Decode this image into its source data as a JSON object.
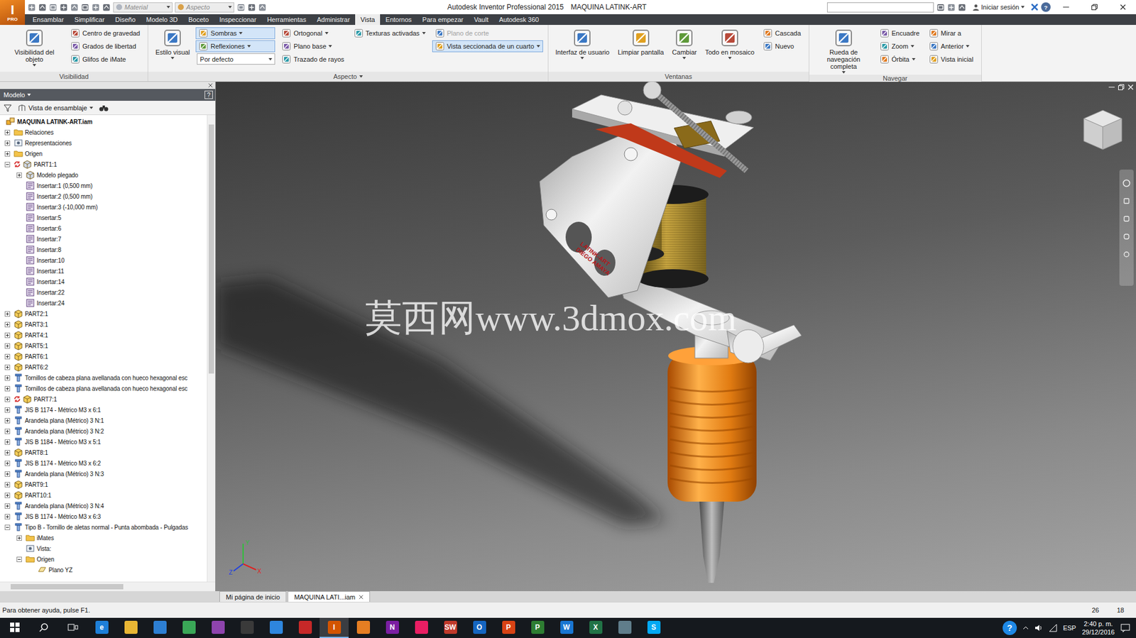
{
  "app": {
    "logo": "I",
    "edition": "PRO"
  },
  "window": {
    "title": "Autodesk Inventor Professional 2015",
    "document": "MAQUINA LATINK-ART"
  },
  "quick_access": {
    "material": "Material",
    "appearance": "Aspecto",
    "sign_in": "Iniciar sesión",
    "help": "?"
  },
  "tabs": [
    {
      "label": "Ensamblar",
      "selected": false
    },
    {
      "label": "Simplificar",
      "selected": false
    },
    {
      "label": "Diseño",
      "selected": false
    },
    {
      "label": "Modelo 3D",
      "selected": false
    },
    {
      "label": "Boceto",
      "selected": false
    },
    {
      "label": "Inspeccionar",
      "selected": false
    },
    {
      "label": "Herramientas",
      "selected": false
    },
    {
      "label": "Administrar",
      "selected": false
    },
    {
      "label": "Vista",
      "selected": true
    },
    {
      "label": "Entornos",
      "selected": false
    },
    {
      "label": "Para empezar",
      "selected": false
    },
    {
      "label": "Vault",
      "selected": false
    },
    {
      "label": "Autodesk 360",
      "selected": false
    }
  ],
  "ribbon": {
    "panels": [
      {
        "label": "Visibilidad",
        "menu": false,
        "groups": [
          {
            "kind": "large",
            "buttons": [
              {
                "label": "Visibilidad del objeto",
                "kind": "button",
                "dropdown": true,
                "selected": false,
                "disabled": false
              }
            ]
          },
          {
            "kind": "column",
            "buttons": [
              {
                "label": "Centro de gravedad",
                "kind": "button",
                "dropdown": false,
                "selected": false,
                "disabled": false
              },
              {
                "label": "Grados de libertad",
                "kind": "button",
                "dropdown": false,
                "selected": false,
                "disabled": false
              },
              {
                "label": "Glifos de iMate",
                "kind": "button",
                "dropdown": false,
                "selected": false,
                "disabled": false
              }
            ]
          }
        ]
      },
      {
        "label": "Aspecto",
        "menu": true,
        "groups": [
          {
            "kind": "large",
            "buttons": [
              {
                "label": "Estilo visual",
                "kind": "button",
                "dropdown": true,
                "selected": false,
                "disabled": false
              }
            ]
          },
          {
            "kind": "column",
            "buttons": [
              {
                "label": "Sombras",
                "kind": "button",
                "dropdown": true,
                "selected": true,
                "disabled": false
              },
              {
                "label": "Reflexiones",
                "kind": "button",
                "dropdown": true,
                "selected": true,
                "disabled": false
              },
              {
                "label": "Por defecto",
                "kind": "select",
                "dropdown": true,
                "selected": false,
                "disabled": false
              }
            ]
          },
          {
            "kind": "column",
            "buttons": [
              {
                "label": "Ortogonal",
                "kind": "button",
                "dropdown": true,
                "selected": false,
                "disabled": false
              },
              {
                "label": "Plano base",
                "kind": "button",
                "dropdown": true,
                "selected": false,
                "disabled": false
              },
              {
                "label": "Trazado de rayos",
                "kind": "button",
                "dropdown": false,
                "selected": false,
                "disabled": false
              }
            ]
          },
          {
            "kind": "column",
            "buttons": [
              {
                "label": "Texturas activadas",
                "kind": "button",
                "dropdown": true,
                "selected": false,
                "disabled": false
              }
            ]
          },
          {
            "kind": "column",
            "buttons": [
              {
                "label": "Plano de corte",
                "kind": "button",
                "dropdown": false,
                "selected": false,
                "disabled": true
              },
              {
                "label": "Vista seccionada de un cuarto",
                "kind": "button",
                "dropdown": true,
                "selected": true,
                "disabled": false
              }
            ]
          }
        ]
      },
      {
        "label": "Ventanas",
        "menu": false,
        "groups": [
          {
            "kind": "large",
            "buttons": [
              {
                "label": "Interfaz de usuario",
                "kind": "button",
                "dropdown": true,
                "selected": false,
                "disabled": false
              },
              {
                "label": "Limpiar pantalla",
                "kind": "button",
                "dropdown": false,
                "selected": false,
                "disabled": false
              },
              {
                "label": "Cambiar",
                "kind": "button",
                "dropdown": true,
                "selected": false,
                "disabled": false
              },
              {
                "label": "Todo en mosaico",
                "kind": "button",
                "dropdown": true,
                "selected": false,
                "disabled": false
              }
            ]
          },
          {
            "kind": "column",
            "buttons": [
              {
                "label": "Cascada",
                "kind": "button",
                "dropdown": false,
                "selected": false,
                "disabled": false
              },
              {
                "label": "Nuevo",
                "kind": "button",
                "dropdown": false,
                "selected": false,
                "disabled": false
              }
            ]
          }
        ]
      },
      {
        "label": "Navegar",
        "menu": false,
        "groups": [
          {
            "kind": "large",
            "buttons": [
              {
                "label": "Rueda de navegación completa",
                "kind": "button",
                "dropdown": true,
                "selected": false,
                "disabled": false
              }
            ]
          },
          {
            "kind": "column",
            "buttons": [
              {
                "label": "Encuadre",
                "kind": "button",
                "dropdown": false,
                "selected": false,
                "disabled": false
              },
              {
                "label": "Zoom",
                "kind": "button",
                "dropdown": true,
                "selected": false,
                "disabled": false
              },
              {
                "label": "Órbita",
                "kind": "button",
                "dropdown": true,
                "selected": false,
                "disabled": false
              }
            ]
          },
          {
            "kind": "column",
            "buttons": [
              {
                "label": "Mirar a",
                "kind": "button",
                "dropdown": false,
                "selected": false,
                "disabled": false
              },
              {
                "label": "Anterior",
                "kind": "button",
                "dropdown": true,
                "selected": false,
                "disabled": false
              },
              {
                "label": "Vista inicial",
                "kind": "button",
                "dropdown": false,
                "selected": false,
                "disabled": false
              }
            ]
          }
        ]
      }
    ]
  },
  "browser": {
    "title": "Modelo",
    "help": "?",
    "view": "Vista de ensamblaje",
    "tree": [
      {
        "label": "MAQUINA LATINK-ART.iam",
        "level": 0,
        "kind": "root",
        "expander": "none",
        "flag": false
      },
      {
        "label": "Relaciones",
        "level": 1,
        "kind": "folder",
        "expander": "collapsed",
        "flag": false
      },
      {
        "label": "Representaciones",
        "level": 1,
        "kind": "view",
        "expander": "collapsed",
        "flag": false
      },
      {
        "label": "Origen",
        "level": 1,
        "kind": "folder",
        "expander": "collapsed",
        "flag": false
      },
      {
        "label": "PART1:1",
        "level": 1,
        "kind": "sheet",
        "expander": "expanded",
        "flag": true
      },
      {
        "label": "Modelo plegado",
        "level": 2,
        "kind": "sheet",
        "expander": "collapsed",
        "flag": false
      },
      {
        "label": "Insertar:1 (0,500 mm)",
        "level": 2,
        "kind": "feature",
        "expander": "none",
        "flag": false
      },
      {
        "label": "Insertar:2 (0,500 mm)",
        "level": 2,
        "kind": "feature",
        "expander": "none",
        "flag": false
      },
      {
        "label": "Insertar:3 (-10,000 mm)",
        "level": 2,
        "kind": "feature",
        "expander": "none",
        "flag": false
      },
      {
        "label": "Insertar:5",
        "level": 2,
        "kind": "feature",
        "expander": "none",
        "flag": false
      },
      {
        "label": "Insertar:6",
        "level": 2,
        "kind": "feature",
        "expander": "none",
        "flag": false
      },
      {
        "label": "Insertar:7",
        "level": 2,
        "kind": "feature",
        "expander": "none",
        "flag": false
      },
      {
        "label": "Insertar:8",
        "level": 2,
        "kind": "feature",
        "expander": "none",
        "flag": false
      },
      {
        "label": "Insertar:10",
        "level": 2,
        "kind": "feature",
        "expander": "none",
        "flag": false
      },
      {
        "label": "Insertar:11",
        "level": 2,
        "kind": "feature",
        "expander": "none",
        "flag": false
      },
      {
        "label": "Insertar:14",
        "level": 2,
        "kind": "feature",
        "expander": "none",
        "flag": false
      },
      {
        "label": "Insertar:22",
        "level": 2,
        "kind": "feature",
        "expander": "none",
        "flag": false
      },
      {
        "label": "Insertar:24",
        "level": 2,
        "kind": "feature",
        "expander": "none",
        "flag": false
      },
      {
        "label": "PART2:1",
        "level": 1,
        "kind": "part",
        "expander": "collapsed",
        "flag": false
      },
      {
        "label": "PART3:1",
        "level": 1,
        "kind": "part",
        "expander": "collapsed",
        "flag": false
      },
      {
        "label": "PART4:1",
        "level": 1,
        "kind": "part",
        "expander": "collapsed",
        "flag": false
      },
      {
        "label": "PART5:1",
        "level": 1,
        "kind": "part",
        "expander": "collapsed",
        "flag": false
      },
      {
        "label": "PART6:1",
        "level": 1,
        "kind": "part",
        "expander": "collapsed",
        "flag": false
      },
      {
        "label": "PART6:2",
        "level": 1,
        "kind": "part",
        "expander": "collapsed",
        "flag": false
      },
      {
        "label": "Tornillos de cabeza plana avellanada con hueco hexagonal esc",
        "level": 1,
        "kind": "fastener",
        "expander": "collapsed",
        "flag": false
      },
      {
        "label": "Tornillos de cabeza plana avellanada con hueco hexagonal esc",
        "level": 1,
        "kind": "fastener",
        "expander": "collapsed",
        "flag": false
      },
      {
        "label": "PART7:1",
        "level": 1,
        "kind": "part",
        "expander": "collapsed",
        "flag": true
      },
      {
        "label": "JIS B 1174 - Métrico M3 x 6:1",
        "level": 1,
        "kind": "fastener",
        "expander": "collapsed",
        "flag": false
      },
      {
        "label": "Arandela plana (Métrico) 3 N:1",
        "level": 1,
        "kind": "fastener",
        "expander": "collapsed",
        "flag": false
      },
      {
        "label": "Arandela plana (Métrico) 3 N:2",
        "level": 1,
        "kind": "fastener",
        "expander": "collapsed",
        "flag": false
      },
      {
        "label": "JIS B 1184 - Métrico M3 x 5:1",
        "level": 1,
        "kind": "fastener",
        "expander": "collapsed",
        "flag": false
      },
      {
        "label": "PART8:1",
        "level": 1,
        "kind": "part",
        "expander": "collapsed",
        "flag": false
      },
      {
        "label": "JIS B 1174 - Métrico M3 x 6:2",
        "level": 1,
        "kind": "fastener",
        "expander": "collapsed",
        "flag": false
      },
      {
        "label": "Arandela plana (Métrico) 3 N:3",
        "level": 1,
        "kind": "fastener",
        "expander": "collapsed",
        "flag": false
      },
      {
        "label": "PART9:1",
        "level": 1,
        "kind": "part",
        "expander": "collapsed",
        "flag": false
      },
      {
        "label": "PART10:1",
        "level": 1,
        "kind": "part",
        "expander": "collapsed",
        "flag": false
      },
      {
        "label": "Arandela plana (Métrico) 3 N:4",
        "level": 1,
        "kind": "fastener",
        "expander": "collapsed",
        "flag": false
      },
      {
        "label": "JIS B 1174 - Métrico M3 x 6:3",
        "level": 1,
        "kind": "fastener",
        "expander": "collapsed",
        "flag": false
      },
      {
        "label": "Tipo B - Tornillo de aletas normal - Punta abombada - Pulgadas",
        "level": 1,
        "kind": "fastener",
        "expander": "expanded",
        "flag": false
      },
      {
        "label": "iMates",
        "level": 2,
        "kind": "folder",
        "expander": "collapsed",
        "flag": false
      },
      {
        "label": "Vista:",
        "level": 2,
        "kind": "view",
        "expander": "none",
        "flag": false
      },
      {
        "label": "Origen",
        "level": 2,
        "kind": "folder",
        "expander": "expanded",
        "flag": false
      },
      {
        "label": "Plano YZ",
        "level": 3,
        "kind": "plane",
        "expander": "none",
        "flag": false
      }
    ]
  },
  "viewport": {
    "watermark": "莫西网www.3dmox.com",
    "engraving": [
      "LATINK-ART",
      "DIEGO AMAYA"
    ],
    "axes": [
      "X",
      "Y",
      "Z"
    ]
  },
  "document_tabs": [
    {
      "label": "Mi página de inicio",
      "selected": false,
      "closable": false
    },
    {
      "label": "MAQUINA LATI...iam",
      "selected": true,
      "closable": true
    }
  ],
  "status_bar": {
    "help": "Para obtener ayuda, pulse F1.",
    "counts": [
      "26",
      "18"
    ]
  },
  "taskbar": {
    "apps": [
      {
        "letter": "e",
        "color": "#1e7fd8",
        "selected": false
      },
      {
        "letter": "",
        "color": "#e8b634",
        "selected": false
      },
      {
        "letter": "",
        "color": "#2d7fd3",
        "selected": false
      },
      {
        "letter": "",
        "color": "#3aa757",
        "selected": false
      },
      {
        "letter": "",
        "color": "#8e44ad",
        "selected": false
      },
      {
        "letter": "",
        "color": "#3a3a3a",
        "selected": false
      },
      {
        "letter": "",
        "color": "#2e86de",
        "selected": false
      },
      {
        "letter": "",
        "color": "#c62828",
        "selected": false
      },
      {
        "letter": "I",
        "color": "#d35400",
        "selected": true
      },
      {
        "letter": "",
        "color": "#e67e22",
        "selected": false
      },
      {
        "letter": "N",
        "color": "#7b1fa2",
        "selected": false
      },
      {
        "letter": "",
        "color": "#e91e63",
        "selected": false
      },
      {
        "letter": "SW",
        "color": "#c0392b",
        "selected": false
      },
      {
        "letter": "O",
        "color": "#1565c0",
        "selected": false
      },
      {
        "letter": "P",
        "color": "#d84315",
        "selected": false
      },
      {
        "letter": "P",
        "color": "#2e7d32",
        "selected": false
      },
      {
        "letter": "W",
        "color": "#1976d2",
        "selected": false
      },
      {
        "letter": "X",
        "color": "#217346",
        "selected": false
      },
      {
        "letter": "",
        "color": "#607d8b",
        "selected": false
      },
      {
        "letter": "S",
        "color": "#03a9f4",
        "selected": false
      }
    ],
    "tray": {
      "help": "?",
      "language": "ESP",
      "time": "2:40 p. m.",
      "date": "29/12/2016"
    }
  }
}
